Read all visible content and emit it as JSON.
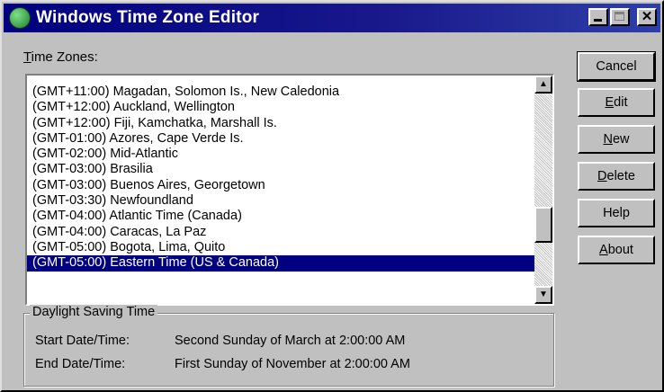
{
  "window": {
    "title": "Windows Time Zone Editor",
    "controls": {
      "minimize": "minimize-icon",
      "maximize": "maximize-icon",
      "close_label": "✕"
    }
  },
  "timezones": {
    "label_mnemonic": "T",
    "label_rest": "ime Zones:",
    "items": [
      "(GMT+11:00) Magadan, Solomon Is., New Caledonia",
      "(GMT+12:00) Auckland, Wellington",
      "(GMT+12:00) Fiji, Kamchatka, Marshall Is.",
      "(GMT-01:00) Azores, Cape Verde Is.",
      "(GMT-02:00) Mid-Atlantic",
      "(GMT-03:00) Brasilia",
      "(GMT-03:00) Buenos Aires, Georgetown",
      "(GMT-03:30) Newfoundland",
      "(GMT-04:00) Atlantic Time (Canada)",
      "(GMT-04:00) Caracas, La Paz",
      "(GMT-05:00) Bogota, Lima, Quito",
      "(GMT-05:00) Eastern Time (US & Canada)"
    ],
    "selected_index": 11
  },
  "dst": {
    "title": "Daylight Saving Time",
    "start_label": "Start Date/Time:",
    "start_value": "Second Sunday of March at 2:00:00 AM",
    "end_label": "End Date/Time:",
    "end_value": "First Sunday of November at 2:00:00 AM"
  },
  "buttons": {
    "cancel": {
      "text": "Cancel"
    },
    "edit": {
      "mn": "E",
      "rest": "dit"
    },
    "new": {
      "mn": "N",
      "rest": "ew"
    },
    "delete": {
      "mn": "D",
      "rest": "elete"
    },
    "help": {
      "text": "Help"
    },
    "about": {
      "mn": "A",
      "rest": "bout"
    }
  }
}
